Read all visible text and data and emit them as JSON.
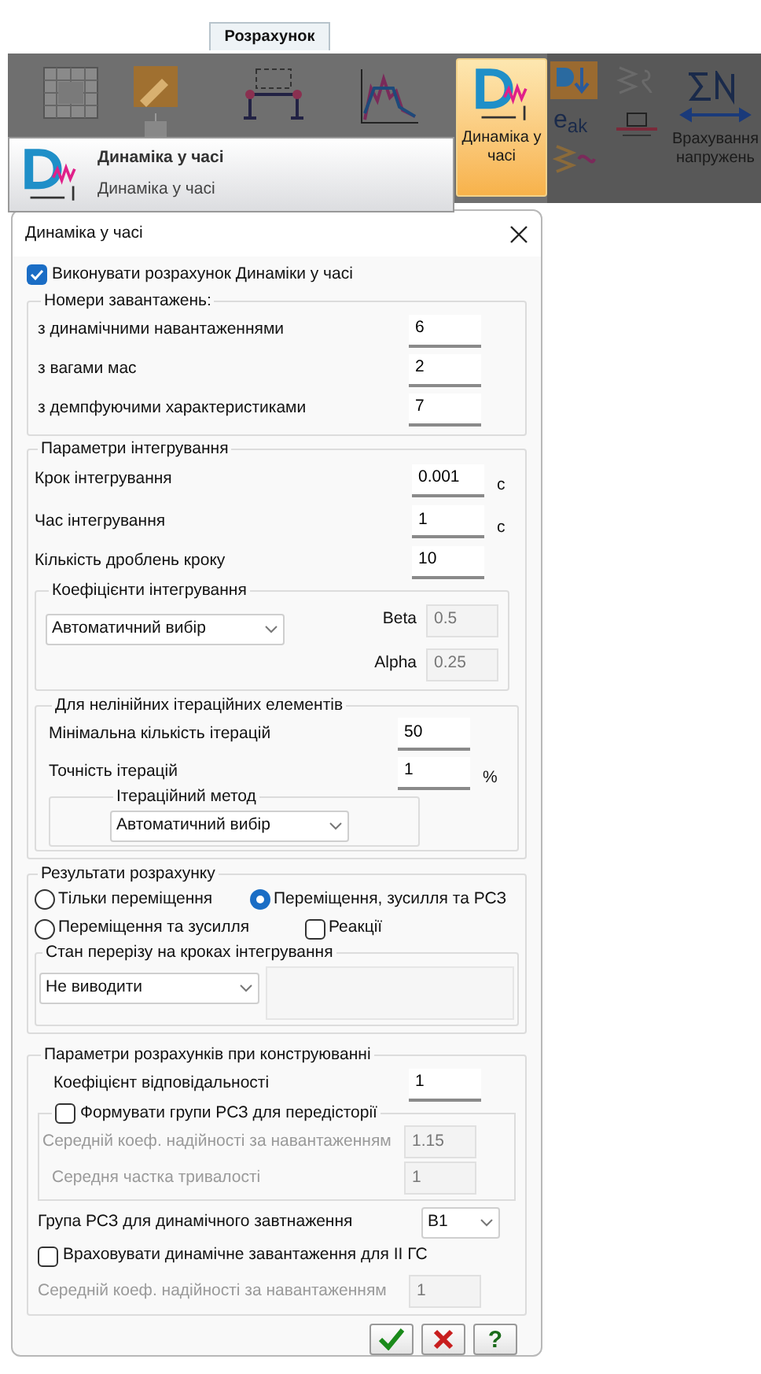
{
  "ribbon": {
    "tab": {
      "label": "Розрахунок",
      "selected": true
    },
    "tooltip": {
      "title": "Динаміка у часі",
      "description": "Динаміка у часі"
    },
    "buttons": [
      {
        "kind": "large",
        "label": "Динаміка у часі",
        "selected": true
      },
      {
        "kind": "text",
        "label": "e$_{ak}$",
        "selected": false
      },
      {
        "kind": "large",
        "label": "Врахування напружень",
        "selected": false
      }
    ]
  },
  "dialog": {
    "title": "Динаміка у часі",
    "run_check": {
      "label": "Виконувати розрахунок Динаміки у часі",
      "checked": true
    },
    "load_numbers": {
      "title": "Номери завантажень:",
      "rows": [
        {
          "label": "з динамічними навантаженнями",
          "value": "6"
        },
        {
          "label": "з вагами мас",
          "value": "2"
        },
        {
          "label": "з демпфуючими характеристиками",
          "value": "7"
        }
      ]
    },
    "integration": {
      "title": "Параметри інтегрування",
      "rows": [
        {
          "label": "Крок інтегрування",
          "value": "0.001",
          "unit": "с"
        },
        {
          "label": "Час інтегрування",
          "value": "1",
          "unit": "с"
        },
        {
          "label": "Кількість дроблень кроку",
          "value": "10"
        }
      ],
      "coefficients": {
        "title": "Коефіцієнти інтегрування",
        "method": "Автоматичний вибір",
        "fields": [
          {
            "label": "Beta",
            "value": "0.5",
            "disabled": true
          },
          {
            "label": "Alpha",
            "value": "0.25",
            "disabled": true
          }
        ]
      },
      "nonlinear": {
        "title": "Для нелінійних ітераційних елементів",
        "rows": [
          {
            "label": "Мінімальна кількість ітерацій",
            "value": "50"
          },
          {
            "label": "Точність ітерацій",
            "value": "1",
            "unit": "%"
          }
        ],
        "method_group": {
          "title": "Ітераційний метод",
          "value": "Автоматичний вибір"
        }
      }
    },
    "results": {
      "title": "Результати розрахунку",
      "options": [
        {
          "label": "Тільки переміщення",
          "selected": false
        },
        {
          "label": "Переміщення, зусилля та РСЗ",
          "selected": true
        },
        {
          "label": "Переміщення та зусилля",
          "selected": false
        }
      ],
      "reactions": {
        "label": "Реакції",
        "checked": false
      },
      "section_state": {
        "title": "Стан перерізу на кроках інтегрування",
        "value": "Не виводити"
      }
    },
    "design": {
      "title": "Параметри розрахунків при конструюванні",
      "responsibility": {
        "label": "Коефіцієнт відповідальності",
        "value": "1"
      },
      "history": {
        "label": "Формувати групи РСЗ для передісторії",
        "checked": false,
        "rows": [
          {
            "label": "Середній коеф. надійності за навантаженням",
            "value": "1.15",
            "disabled": true
          },
          {
            "label": "Середня частка тривалості",
            "value": "1",
            "disabled": true
          }
        ]
      },
      "group": {
        "label": "Група РСЗ для динамічного завтнаження",
        "value": "B1"
      },
      "serviceability": {
        "label": "Враховувати динамічне завантаження для II ГС",
        "checked": false,
        "rows": [
          {
            "label": "Середній коеф. надійності за навантаженням",
            "value": "1",
            "disabled": true
          }
        ]
      }
    },
    "buttons": [
      {
        "kind": "ok"
      },
      {
        "kind": "cancel"
      },
      {
        "kind": "help",
        "label": "?"
      }
    ]
  }
}
